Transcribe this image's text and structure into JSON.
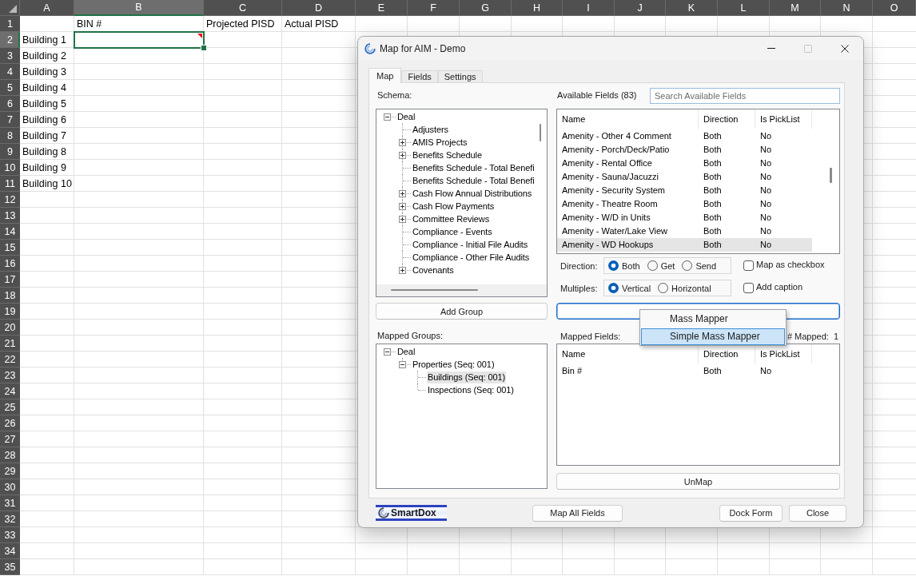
{
  "spreadsheet": {
    "columns": [
      {
        "label": "A",
        "selected": false
      },
      {
        "label": "B",
        "selected": true
      },
      {
        "label": "C",
        "selected": false
      },
      {
        "label": "D",
        "selected": false
      },
      {
        "label": "E",
        "selected": false
      },
      {
        "label": "F",
        "selected": false
      },
      {
        "label": "G",
        "selected": false
      },
      {
        "label": "H",
        "selected": false
      },
      {
        "label": "I",
        "selected": false
      },
      {
        "label": "J",
        "selected": false
      },
      {
        "label": "K",
        "selected": false
      },
      {
        "label": "L",
        "selected": false
      },
      {
        "label": "M",
        "selected": false
      },
      {
        "label": "N",
        "selected": false
      },
      {
        "label": "O",
        "selected": false
      }
    ],
    "rows": [
      {
        "label": "1",
        "selected": false,
        "cells": [
          {
            "selected": false,
            "note": false
          },
          {
            "text": "BIN #",
            "selected": false,
            "note": false
          },
          {
            "text": "Projected PISD",
            "selected": false,
            "note": false
          },
          {
            "text": "Actual PISD",
            "selected": false,
            "note": false
          }
        ]
      },
      {
        "label": "2",
        "selected": true,
        "cells": [
          {
            "text": "Building 1",
            "selected": false,
            "note": false
          },
          {
            "selected": true,
            "note": true
          }
        ]
      },
      {
        "label": "3",
        "selected": false,
        "cells": [
          {
            "text": "Building 2",
            "selected": false,
            "note": false
          }
        ]
      },
      {
        "label": "4",
        "selected": false,
        "cells": [
          {
            "text": "Building 3",
            "selected": false,
            "note": false
          }
        ]
      },
      {
        "label": "5",
        "selected": false,
        "cells": [
          {
            "text": "Building 4",
            "selected": false,
            "note": false
          }
        ]
      },
      {
        "label": "6",
        "selected": false,
        "cells": [
          {
            "text": "Building 5",
            "selected": false,
            "note": false
          }
        ]
      },
      {
        "label": "7",
        "selected": false,
        "cells": [
          {
            "text": "Building 6",
            "selected": false,
            "note": false
          }
        ]
      },
      {
        "label": "8",
        "selected": false,
        "cells": [
          {
            "text": "Building 7",
            "selected": false,
            "note": false
          }
        ]
      },
      {
        "label": "9",
        "selected": false,
        "cells": [
          {
            "text": "Building 8",
            "selected": false,
            "note": false
          }
        ]
      },
      {
        "label": "10",
        "selected": false,
        "cells": [
          {
            "text": "Building 9",
            "selected": false,
            "note": false
          }
        ]
      },
      {
        "label": "11",
        "selected": false,
        "cells": [
          {
            "text": "Building 10",
            "selected": false,
            "note": false
          }
        ]
      },
      {
        "label": "12",
        "selected": false
      },
      {
        "label": "13",
        "selected": false
      },
      {
        "label": "14",
        "selected": false
      },
      {
        "label": "15",
        "selected": false
      },
      {
        "label": "16",
        "selected": false
      },
      {
        "label": "17",
        "selected": false
      },
      {
        "label": "18",
        "selected": false
      },
      {
        "label": "19",
        "selected": false
      },
      {
        "label": "20",
        "selected": false
      },
      {
        "label": "21",
        "selected": false
      },
      {
        "label": "22",
        "selected": false
      },
      {
        "label": "23",
        "selected": false
      },
      {
        "label": "24",
        "selected": false
      },
      {
        "label": "25",
        "selected": false
      },
      {
        "label": "26",
        "selected": false
      },
      {
        "label": "27",
        "selected": false
      },
      {
        "label": "28",
        "selected": false
      },
      {
        "label": "29",
        "selected": false
      },
      {
        "label": "30",
        "selected": false
      },
      {
        "label": "31",
        "selected": false
      },
      {
        "label": "32",
        "selected": false
      },
      {
        "label": "33",
        "selected": false
      },
      {
        "label": "34",
        "selected": false
      },
      {
        "label": "35",
        "selected": false
      }
    ]
  },
  "dialog": {
    "title": "Map for AIM - Demo",
    "controls": [
      {
        "kind": "minimize",
        "disabled": false
      },
      {
        "kind": "maximize",
        "disabled": true
      },
      {
        "kind": "close",
        "disabled": false
      }
    ],
    "tabs": [
      {
        "label": "Map",
        "selected": true
      },
      {
        "label": "Fields",
        "selected": false
      },
      {
        "label": "Settings",
        "selected": false
      }
    ],
    "schema": {
      "label": "Schema:",
      "tree": [
        {
          "text": "Deal",
          "kind": "branch",
          "expanded": true,
          "children": [
            {
              "text": "Adjusters",
              "kind": "leaf",
              "expanded": false
            },
            {
              "text": "AMIS Projects",
              "kind": "branch",
              "expanded": false
            },
            {
              "text": "Benefits Schedule",
              "kind": "branch",
              "expanded": false
            },
            {
              "text": "Benefits Schedule - Total Benefi",
              "kind": "leaf",
              "expanded": false
            },
            {
              "text": "Benefits Schedule - Total Benefi",
              "kind": "leaf",
              "expanded": false
            },
            {
              "text": "Cash Flow Annual Distributions",
              "kind": "branch",
              "expanded": false
            },
            {
              "text": "Cash Flow Payments",
              "kind": "branch",
              "expanded": false
            },
            {
              "text": "Committee Reviews",
              "kind": "branch",
              "expanded": false
            },
            {
              "text": "Compliance - Events",
              "kind": "leaf",
              "expanded": false
            },
            {
              "text": "Compliance - Initial File Audits",
              "kind": "leaf",
              "expanded": false
            },
            {
              "text": "Compliance - Other File Audits",
              "kind": "leaf",
              "expanded": false
            },
            {
              "text": "Covenants",
              "kind": "branch",
              "expanded": false
            }
          ]
        }
      ]
    },
    "add_group_button": "Add Group",
    "mapped_groups": {
      "label": "Mapped Groups:",
      "tree": [
        {
          "text": "Deal",
          "kind": "branch",
          "expanded": true,
          "selected": false,
          "children": [
            {
              "text": "Properties (Seq: 001)",
              "kind": "branch",
              "expanded": true,
              "selected": false,
              "children": [
                {
                  "text": "Buildings (Seq: 001)",
                  "kind": "leaf",
                  "expanded": false,
                  "selected": true
                },
                {
                  "text": "Inspections (Seq: 001)",
                  "kind": "leaf",
                  "expanded": false,
                  "selected": false
                }
              ]
            }
          ]
        }
      ]
    },
    "available_fields": {
      "label": "Available Fields (83)",
      "search": {
        "placeholder": "Search Available Fields"
      },
      "columns": [
        "Name",
        "Direction",
        "Is PickList"
      ],
      "rows": [
        {
          "cells": [
            "Amenity - Other 4 Comment",
            "Both",
            "No"
          ],
          "selected": false
        },
        {
          "cells": [
            "Amenity - Porch/Deck/Patio",
            "Both",
            "No"
          ],
          "selected": false
        },
        {
          "cells": [
            "Amenity - Rental Office",
            "Both",
            "No"
          ],
          "selected": false
        },
        {
          "cells": [
            "Amenity - Sauna/Jacuzzi",
            "Both",
            "No"
          ],
          "selected": false
        },
        {
          "cells": [
            "Amenity - Security System",
            "Both",
            "No"
          ],
          "selected": false
        },
        {
          "cells": [
            "Amenity - Theatre Room",
            "Both",
            "No"
          ],
          "selected": false
        },
        {
          "cells": [
            "Amenity - W/D in Units",
            "Both",
            "No"
          ],
          "selected": false
        },
        {
          "cells": [
            "Amenity - Water/Lake View",
            "Both",
            "No"
          ],
          "selected": false
        },
        {
          "cells": [
            "Amenity - WD Hookups",
            "Both",
            "No"
          ],
          "selected": true
        }
      ]
    },
    "direction": {
      "label": "Direction:",
      "options": [
        {
          "label": "Both",
          "selected": true
        },
        {
          "label": "Get",
          "selected": false
        },
        {
          "label": "Send",
          "selected": false
        }
      ]
    },
    "map_as_checkbox": {
      "label": "Map as checkbox",
      "checked": false
    },
    "multiples": {
      "label": "Multiples:",
      "options": [
        {
          "label": "Vertical",
          "selected": true
        },
        {
          "label": "Horizontal",
          "selected": false
        }
      ]
    },
    "add_caption": {
      "label": "Add caption",
      "checked": false
    },
    "context_menu": {
      "items": [
        {
          "label": "Mass Mapper",
          "selected": false
        },
        {
          "label": "Simple Mass Mapper",
          "selected": true
        }
      ]
    },
    "mapped_fields": {
      "label": "Mapped Fields:",
      "count_label": "# Mapped:",
      "count": "1",
      "columns": [
        "Name",
        "Direction",
        "Is PickList"
      ],
      "rows": [
        {
          "cells": [
            "Bin #",
            "Both",
            "No"
          ],
          "selected": false
        }
      ]
    },
    "unmap_button": "UnMap",
    "logo": "SmartDox",
    "footer_buttons": [
      "Map All Fields",
      "Dock Form",
      "Close"
    ]
  }
}
